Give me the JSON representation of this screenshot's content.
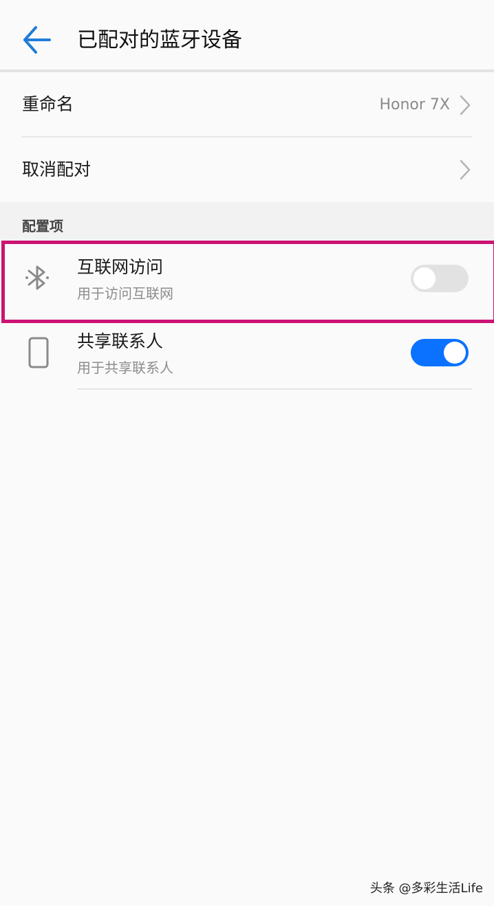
{
  "header": {
    "title": "已配对的蓝牙设备",
    "back_icon": "arrow-left-icon",
    "accent_color": "#1f7dd9"
  },
  "settings": {
    "rename": {
      "label": "重命名",
      "value": "Honor 7X"
    },
    "unpair": {
      "label": "取消配对"
    }
  },
  "config_section": {
    "title": "配置项",
    "items": [
      {
        "icon": "bluetooth-icon",
        "title": "互联网访问",
        "subtitle": "用于访问互联网",
        "enabled": false
      },
      {
        "icon": "phone-icon",
        "title": "共享联系人",
        "subtitle": "用于共享联系人",
        "enabled": true
      }
    ]
  },
  "highlight_color": "#cc1273",
  "toggle_on_color": "#0a72ff",
  "watermark": "头条 @多彩生活Life"
}
